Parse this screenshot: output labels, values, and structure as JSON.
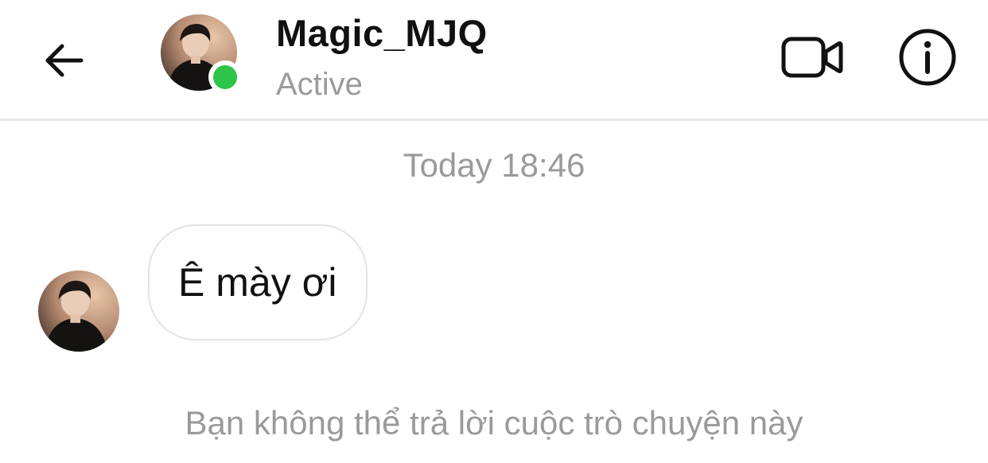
{
  "header": {
    "contact_name": "Magic_MJQ",
    "status": "Active",
    "online_color": "#2ec44a",
    "icons": {
      "back": "back-arrow-icon",
      "video": "video-call-icon",
      "info": "info-icon"
    }
  },
  "thread": {
    "timestamp": "Today 18:46",
    "messages": [
      {
        "sender": "Magic_MJQ",
        "text": "Ê mày ơi"
      }
    ],
    "notice": "Bạn không thể trả lời cuộc trò chuyện này"
  }
}
